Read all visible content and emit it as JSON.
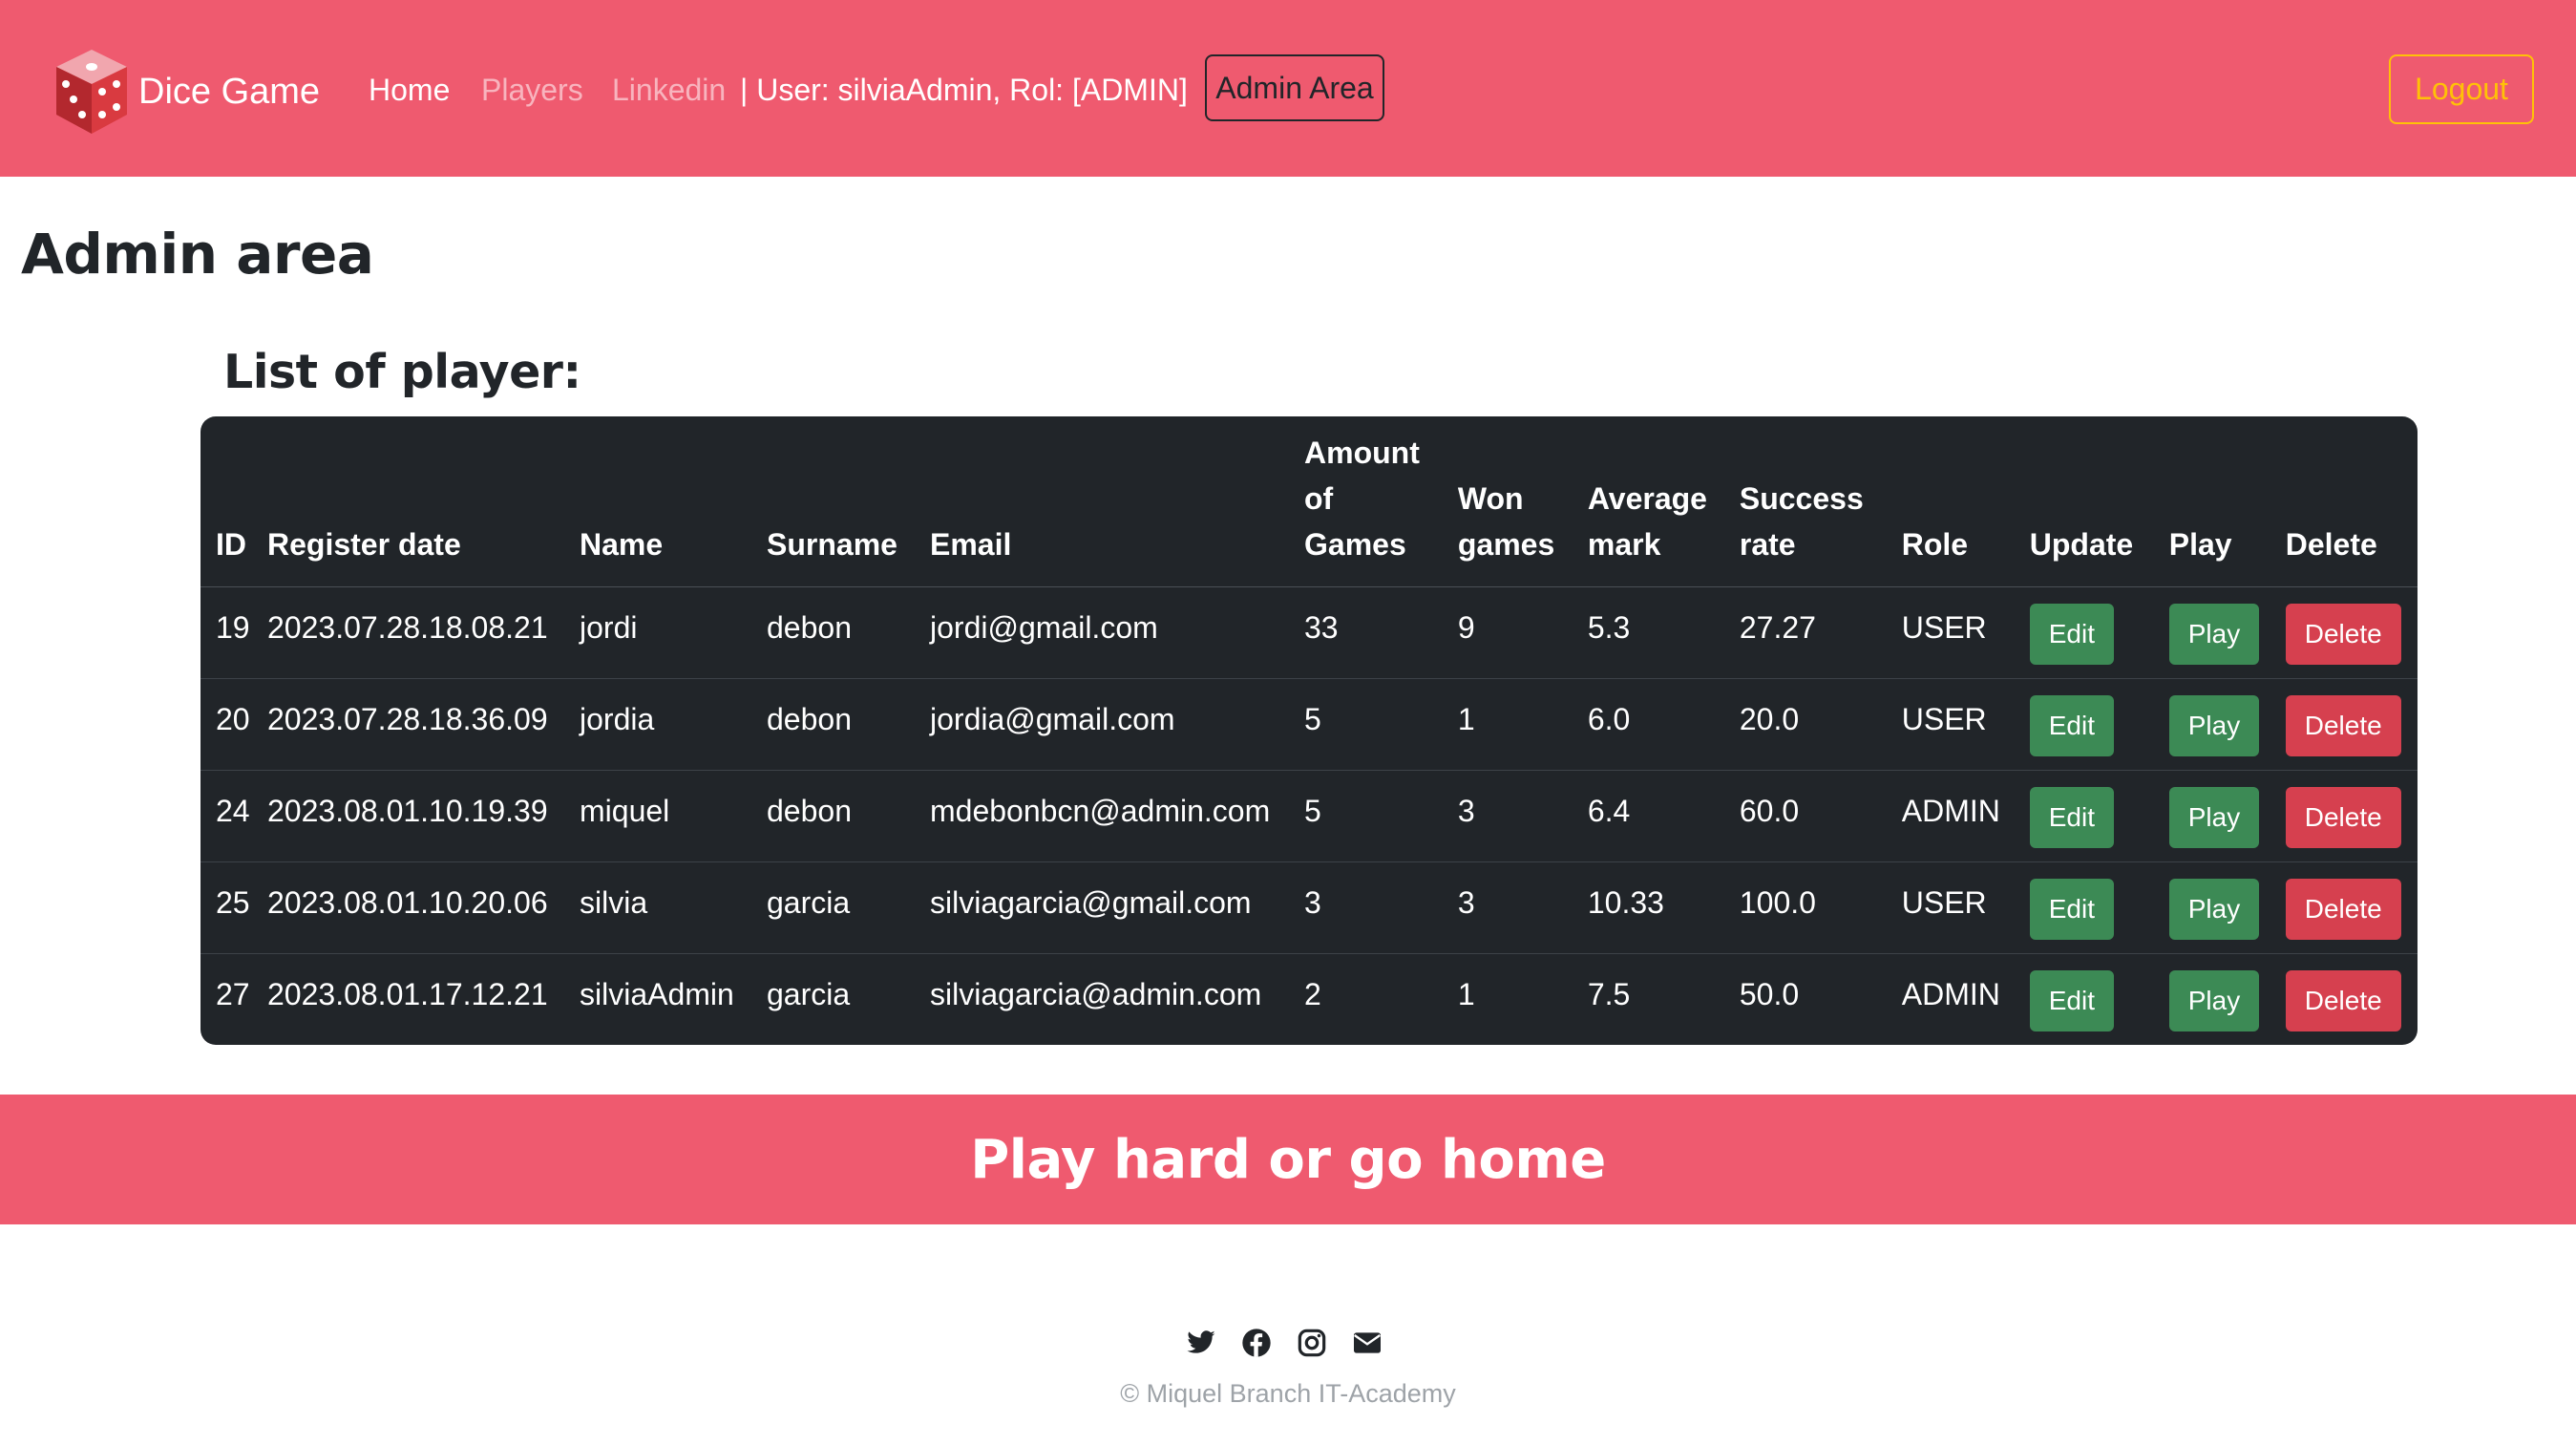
{
  "navbar": {
    "brand": "Dice Game",
    "links": [
      {
        "label": "Home"
      },
      {
        "label": "Players"
      },
      {
        "label": "Linkedin"
      }
    ],
    "user_info": "| User: silviaAdmin, Rol: [ADMIN]",
    "admin_button": "Admin Area",
    "logout_button": "Logout"
  },
  "page_title": "Admin area",
  "list_title": "List of player:",
  "table": {
    "headers": {
      "id": "ID",
      "register_date": "Register date",
      "name": "Name",
      "surname": "Surname",
      "email": "Email",
      "amount": "Amount of Games",
      "won": "Won games",
      "average": "Average mark",
      "success": "Success rate",
      "role": "Role",
      "update": "Update",
      "play": "Play",
      "delete": "Delete"
    },
    "rows": [
      {
        "id": "19",
        "date": "2023.07.28.18.08.21",
        "name": "jordi",
        "surname": "debon",
        "email": "jordi@gmail.com",
        "amount": "33",
        "won": "9",
        "average": "5.3",
        "success": "27.27",
        "role": "USER"
      },
      {
        "id": "20",
        "date": "2023.07.28.18.36.09",
        "name": "jordia",
        "surname": "debon",
        "email": "jordia@gmail.com",
        "amount": "5",
        "won": "1",
        "average": "6.0",
        "success": "20.0",
        "role": "USER"
      },
      {
        "id": "24",
        "date": "2023.08.01.10.19.39",
        "name": "miquel",
        "surname": "debon",
        "email": "mdebonbcn@admin.com",
        "amount": "5",
        "won": "3",
        "average": "6.4",
        "success": "60.0",
        "role": "ADMIN"
      },
      {
        "id": "25",
        "date": "2023.08.01.10.20.06",
        "name": "silvia",
        "surname": "garcia",
        "email": "silviagarcia@gmail.com",
        "amount": "3",
        "won": "3",
        "average": "10.33",
        "success": "100.0",
        "role": "USER"
      },
      {
        "id": "27",
        "date": "2023.08.01.17.12.21",
        "name": "silviaAdmin",
        "surname": "garcia",
        "email": "silviagarcia@admin.com",
        "amount": "2",
        "won": "1",
        "average": "7.5",
        "success": "50.0",
        "role": "ADMIN"
      }
    ],
    "buttons": {
      "edit": "Edit",
      "play": "Play",
      "delete": "Delete"
    }
  },
  "banner": "Play hard or go home",
  "social_icons": [
    "twitter-icon",
    "facebook-icon",
    "instagram-icon",
    "envelope-icon"
  ],
  "copyright": "© Miquel Branch IT-Academy",
  "colors": {
    "accent": "#ef5a6f",
    "table_bg": "#212529",
    "edit": "#3c8a55",
    "delete": "#d6404f",
    "logout": "#ffc107"
  }
}
